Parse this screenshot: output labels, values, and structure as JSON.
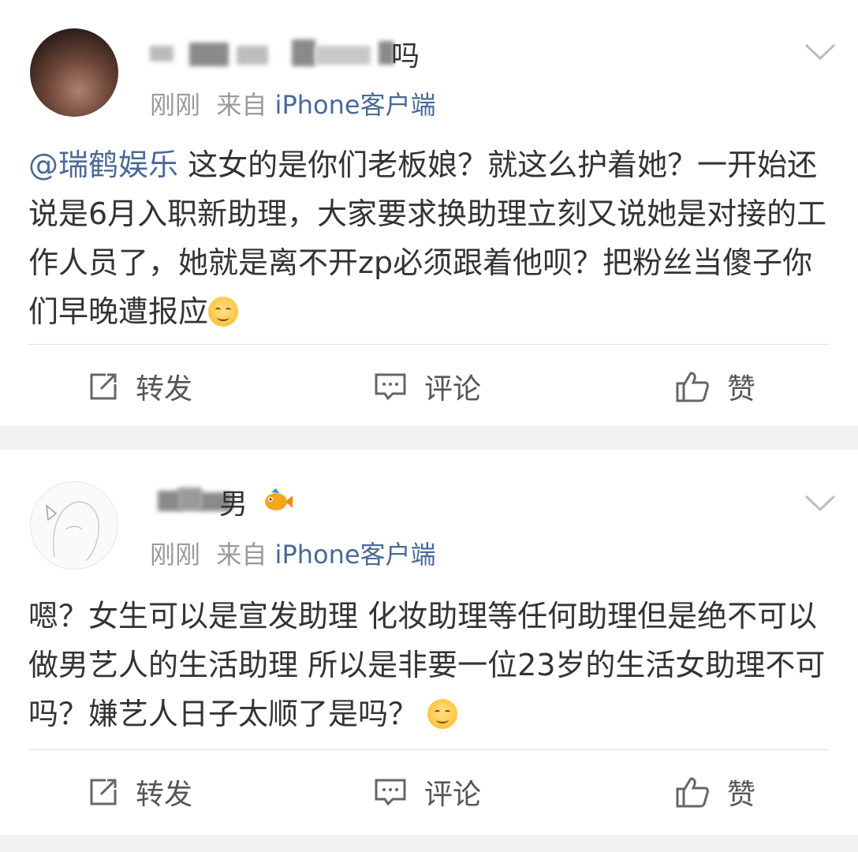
{
  "posts": [
    {
      "username_visible_suffix": "吗",
      "meta": {
        "time": "刚刚",
        "from_prefix": "来自",
        "source": "iPhone客户端"
      },
      "content": {
        "mention": "@瑞鹤娱乐",
        "text": " 这女的是你们老板娘？就这么护着她？一开始还说是6月入职新助理，大家要求换助理立刻又说她是对接的工作人员了，她就是离不开zp必须跟着他呗？把粉丝当傻子你们早晚遭报应"
      },
      "actions": {
        "repost": "转发",
        "comment": "评论",
        "like": "赞"
      }
    },
    {
      "username_visible_suffix": "男",
      "meta": {
        "time": "刚刚",
        "from_prefix": "来自",
        "source": "iPhone客户端"
      },
      "content": {
        "text": "嗯？女生可以是宣发助理 化妆助理等任何助理但是绝不可以做男艺人的生活助理 所以是非要一位23岁的生活女助理不可吗？嫌艺人日子太顺了是吗？"
      },
      "actions": {
        "repost": "转发",
        "comment": "评论",
        "like": "赞"
      }
    }
  ],
  "icons": {
    "repost": "repost-icon",
    "comment": "comment-icon",
    "like": "thumbs-up-icon",
    "more": "chevron-down-icon",
    "emoji": "smile-emoji-icon",
    "badge": "fish-badge-icon"
  },
  "colors": {
    "link": "#4a6a95",
    "meta": "#9a9a9a",
    "text": "#333333",
    "background": "#f2f2f2"
  }
}
